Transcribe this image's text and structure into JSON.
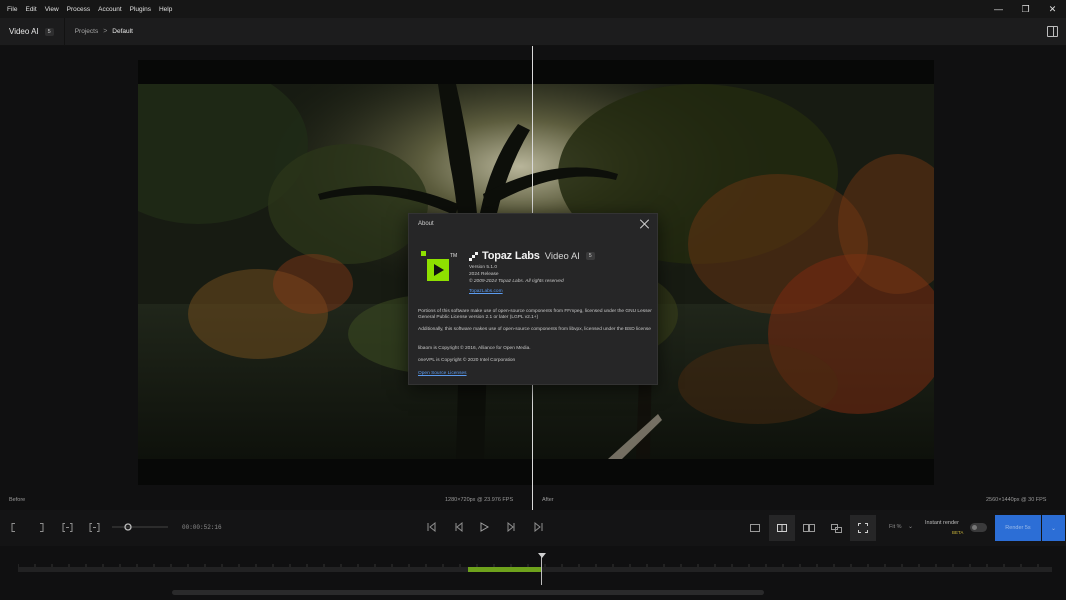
{
  "menu": [
    "File",
    "Edit",
    "View",
    "Process",
    "Account",
    "Plugins",
    "Help"
  ],
  "window_controls": {
    "minimize": "—",
    "restore": "❐",
    "close": "✕"
  },
  "header": {
    "app_title": "Video AI",
    "app_badge": "5",
    "breadcrumb": {
      "projects": "Projects",
      "separator": ">",
      "current": "Default"
    }
  },
  "preview": {
    "before_label": "Before",
    "before_info": "1280×720px @ 23.976 FPS",
    "after_label": "After",
    "after_info": "2560×1440px @ 30 FPS"
  },
  "about": {
    "title": "About",
    "brand": "Topaz Labs",
    "product": "Video AI",
    "badge": "5",
    "version": "Version 5.1.0",
    "release": "2024 Release",
    "copyright": "© 2009-2024 Topaz Labs. All rights reserved",
    "website": "TopazLabs.com",
    "paragraphs": [
      "Portions of this software make use of open-source components from FFmpeg, licensed under the GNU Lesser General Public License version 2.1 or later (LGPL v2.1+)",
      "Additionally, this software makes use of open-source components from libvpx, licensed under the BSD license",
      "libaom is Copyright © 2016, Alliance for Open Media.",
      "oneVPL is Copyright © 2020 Intel Corporation"
    ],
    "licenses_link": "Open Source Licenses"
  },
  "controls": {
    "timecode": "00:00:52:16",
    "zoom": "Fit %",
    "instant_render": "Instant render",
    "beta": "BETA",
    "render_button": "Render 5s"
  },
  "timeline": {
    "selection_start_fraction": 0.435,
    "selection_end_fraction": 0.507,
    "playhead_fraction": 0.506
  },
  "colors": {
    "accent_green": "#6ea21c",
    "logo_green": "#8ee000",
    "render_blue": "#2c6ed6",
    "link_blue": "#5b9bf0"
  }
}
